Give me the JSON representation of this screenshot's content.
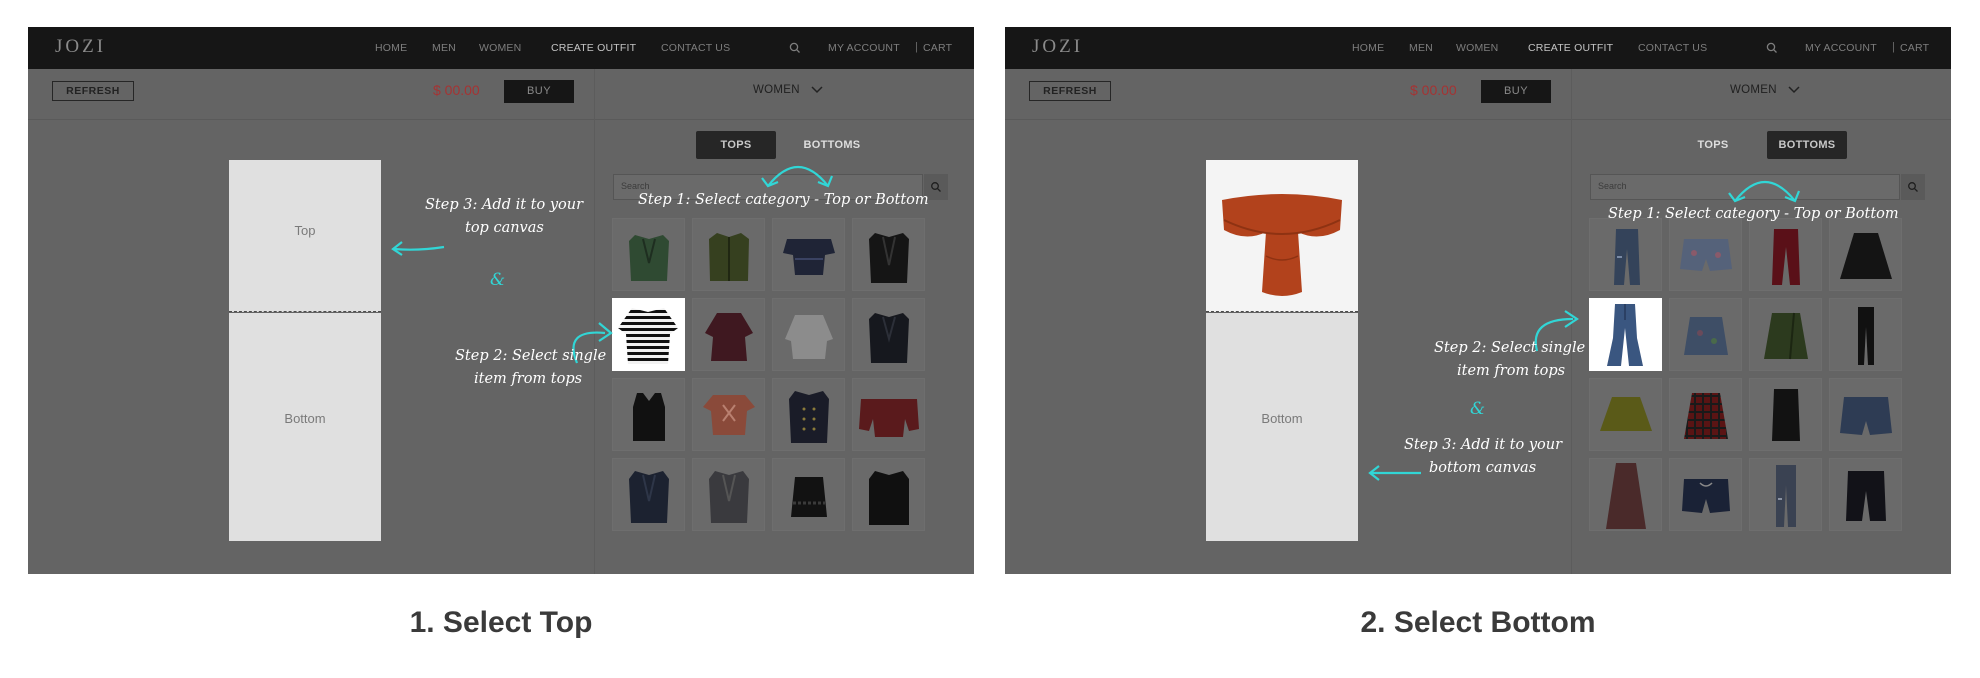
{
  "colors": {
    "accent": "#31d6d6",
    "price": "#a53333",
    "navbar": "#161616",
    "overlay": "#646464"
  },
  "panels": [
    {
      "header": {
        "logo": "JOZI",
        "nav": [
          "HOME",
          "MEN",
          "WOMEN",
          "CREATE OUTFIT",
          "CONTACT US"
        ],
        "active_nav": "CREATE OUTFIT",
        "search_icon": "search-icon",
        "account": "MY ACCOUNT",
        "separator": "|",
        "cart": "CART"
      },
      "toolbar": {
        "refresh": "REFRESH",
        "price": "$ 00.00",
        "buy": "BUY",
        "gender": "WOMEN",
        "gender_icon": "chevron-down-icon"
      },
      "tabs": {
        "tops": "TOPS",
        "bottoms": "BOTTOMS",
        "active": "TOPS"
      },
      "search": {
        "placeholder": "Search",
        "icon": "search-icon"
      },
      "canvas": {
        "top": "Top",
        "bottom": "Bottom"
      },
      "items": [
        "green blazer",
        "olive jacket",
        "navy ruffle top",
        "black blazer",
        "striped sweater",
        "burgundy blouse",
        "grey sweatshirt",
        "black jacket",
        "black tank top",
        "rust print tee",
        "military jacket",
        "red off-shoulder top",
        "navy blazer",
        "grey blazer",
        "black lace cami",
        "black coat"
      ],
      "selected_item": "striped sweater",
      "annotations": {
        "step1": "Step 1: Select category - Top or Bottom",
        "step2_line1": "Step 2: Select single",
        "step2_line2": "item from tops",
        "step3_line1": "Step 3: Add it to your",
        "step3_line2": "top canvas",
        "amp": "&"
      },
      "caption": "1. Select Top"
    },
    {
      "header": {
        "logo": "JOZI",
        "nav": [
          "HOME",
          "MEN",
          "WOMEN",
          "CREATE OUTFIT",
          "CONTACT US"
        ],
        "active_nav": "CREATE OUTFIT",
        "search_icon": "search-icon",
        "account": "MY ACCOUNT",
        "separator": "|",
        "cart": "CART"
      },
      "toolbar": {
        "refresh": "REFRESH",
        "price": "$ 00.00",
        "buy": "BUY",
        "gender": "WOMEN",
        "gender_icon": "chevron-down-icon"
      },
      "tabs": {
        "tops": "TOPS",
        "bottoms": "BOTTOMS",
        "active": "BOTTOMS"
      },
      "search": {
        "placeholder": "Search",
        "icon": "search-icon"
      },
      "canvas": {
        "top": "",
        "bottom": "Bottom",
        "top_item": "rust off-shoulder top"
      },
      "items": [
        "ripped jeans",
        "floral denim shorts",
        "red trousers",
        "black skater skirt",
        "flared jeans",
        "denim mini skirt",
        "olive wrap skirt",
        "black leggings",
        "mustard skater skirt",
        "red plaid skirt",
        "black pencil skirt",
        "denim shorts",
        "mauve maxi skirt",
        "navy shorts",
        "distressed jeans",
        "black bermuda shorts"
      ],
      "selected_item": "flared jeans",
      "annotations": {
        "step1": "Step 1: Select category - Top or Bottom",
        "step2_line1": "Step 2: Select single",
        "step2_line2": "item from tops",
        "step3_line1": "Step 3: Add it to your",
        "step3_line2": "bottom canvas",
        "amp": "&"
      },
      "caption": "2. Select Bottom"
    }
  ]
}
